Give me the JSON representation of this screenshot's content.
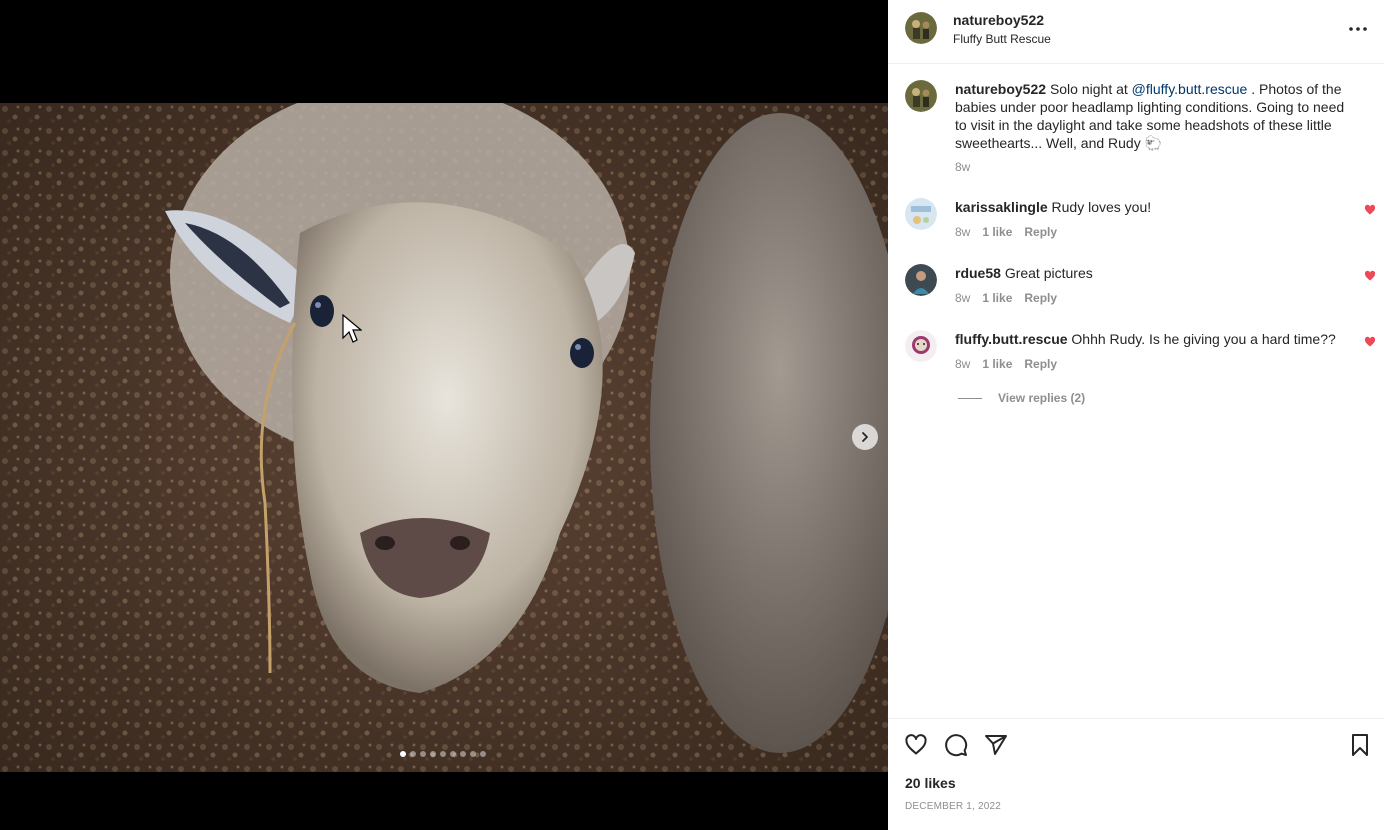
{
  "post": {
    "username": "natureboy522",
    "location": "Fluffy Butt Rescue",
    "media": {
      "image_description": "sheep",
      "slide_count": 9,
      "active_slide": 1
    }
  },
  "caption": {
    "username": "natureboy522",
    "text_before": "Solo night at ",
    "mention": "@fluffy.butt.rescue",
    "text_after": " . Photos of the babies under poor headlamp lighting conditions. Going to need to visit in the daylight and take some headshots of these little sweethearts... Well, and Rudy 🐑",
    "time": "8w"
  },
  "comments": [
    {
      "username": "karissaklingle",
      "text": "Rudy loves you!",
      "time": "8w",
      "likes": "1 like",
      "reply": "Reply"
    },
    {
      "username": "rdue58",
      "text": "Great pictures",
      "time": "8w",
      "likes": "1 like",
      "reply": "Reply"
    },
    {
      "username": "fluffy.butt.rescue",
      "text": "Ohhh Rudy. Is he giving you a hard time??",
      "time": "8w",
      "likes": "1 like",
      "reply": "Reply"
    }
  ],
  "view_replies": "View replies (2)",
  "footer": {
    "likes": "20 likes",
    "date": "December 1, 2022"
  },
  "icons": {
    "heart": "heart-icon",
    "comment": "comment-icon",
    "share": "share-icon",
    "bookmark": "bookmark-icon",
    "more": "more-icon",
    "next": "chevron-right-icon"
  },
  "colors": {
    "like_red": "#ed4956",
    "mention_blue": "#00376b",
    "muted": "#8e8e8e"
  }
}
